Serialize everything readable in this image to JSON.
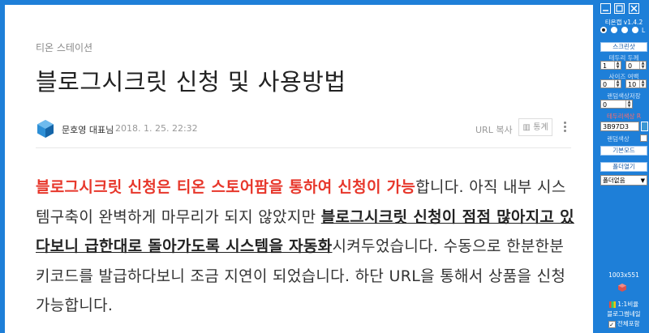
{
  "post": {
    "category": "티온 스테이션",
    "title": "블로그시크릿 신청 및 사용방법",
    "author": "문호영 대표님",
    "date": "2018. 1. 25. 22:32",
    "url_copy": "URL 복사",
    "stats_label": "통계",
    "body": {
      "red_intro": "블로그시크릿 신청은 티온 스토어팜을 통하여 신청이 가능",
      "after_red": "합니다. 아직 내부 시스템구축이 완벽하게 마무리가 되지 않았지만 ",
      "underline_1": "블로그시크릿 신청이 점점 많아지고 있다보니 급한대로 돌아가도록 시스템을 자동화",
      "after_ul": "시켜두었습니다. 수동으로 한분한분 키코드를 발급하다보니 조금 지연이 되었습니다. 하단 URL을 통해서 상품을 신청가능합니다."
    }
  },
  "panel": {
    "title": "티온캡 v1.4.2",
    "radio_label": "L",
    "screenshot_btn": "스크린샷",
    "border_thickness_label": "테두리 두께",
    "border_a": "1",
    "border_b": "0",
    "size_margin_label": "사이즈 여백",
    "size_a": "0",
    "size_b": "10",
    "round_corner_label": "랜덤색상저장",
    "round_value": "0",
    "border_color_label": "테두리색상 R",
    "color_hex": "3B97D3",
    "random_color_label": "랜덤색상",
    "basic_mode_btn": "기본모드",
    "folder_open_btn": "폴더열기",
    "folder_select": "폴더없음",
    "dimensions": "1003x551",
    "ratio_label": "1:1비율",
    "blog_thumb_label": "블로그썸네일",
    "fullscreen_label": "전체포함"
  },
  "colors": {
    "accent_blue": "#1e7fd8",
    "highlight_red": "#e7372b",
    "swatch": "#3b97d3"
  }
}
